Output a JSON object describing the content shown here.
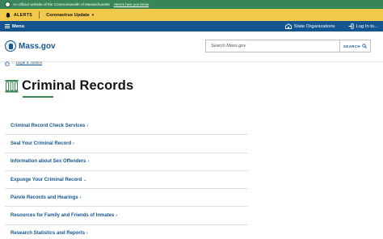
{
  "official_banner": {
    "text": "An official website of the Commonwealth of Massachusetts",
    "link": "Here's how you know"
  },
  "alerts": {
    "label": "ALERTS",
    "item": "Coronavirus Update"
  },
  "topnav": {
    "menu": "Menu",
    "state_orgs": "State Organizations",
    "login": "Log In to..."
  },
  "header": {
    "logo": "Mass.gov",
    "search_placeholder": "Search Mass.gov",
    "search_button": "SEARCH"
  },
  "breadcrumb": {
    "crumb": "Legal & Justice"
  },
  "page": {
    "title": "Criminal Records"
  },
  "links": [
    {
      "label": "Criminal Record Check Services",
      "arrow": "›"
    },
    {
      "label": "Seal Your Criminal Record",
      "arrow": "›"
    },
    {
      "label": "Information about Sex Offenders",
      "arrow": "›"
    },
    {
      "label": "Expunge Your Criminal Record",
      "arrow": "⌄"
    },
    {
      "label": "Parole Records and Hearings",
      "arrow": "›"
    },
    {
      "label": "Resources for Family and Friends of Inmates",
      "arrow": "›"
    },
    {
      "label": "Research Statistics and Reports",
      "arrow": "›"
    }
  ],
  "colors": {
    "official_green": "#388557",
    "alert_yellow": "#f2c94c",
    "nav_blue": "#14558f",
    "rule_green": "#388557"
  },
  "icons": [
    "seal-icon",
    "bell-icon",
    "hamburger-icon",
    "building-icon",
    "login-icon",
    "search-icon",
    "home-icon",
    "records-icon"
  ]
}
